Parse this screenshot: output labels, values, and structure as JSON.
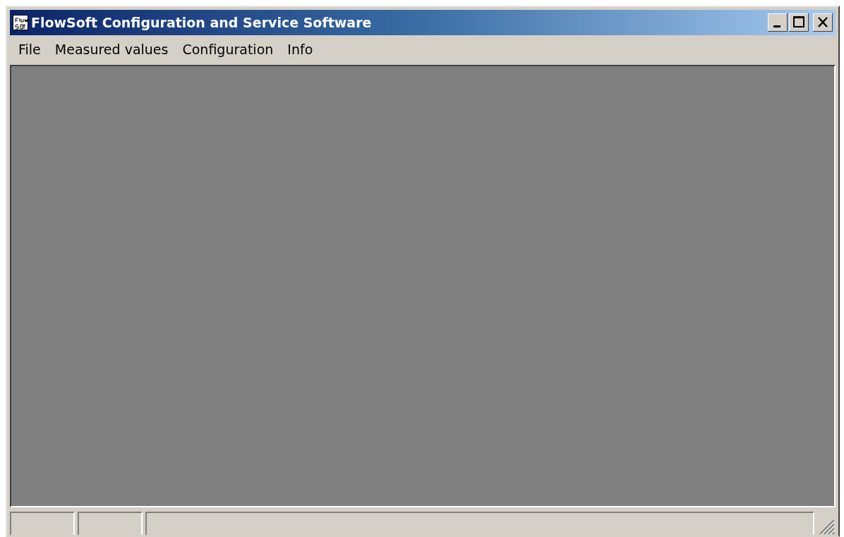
{
  "window": {
    "title": "FlowSoft Configuration and Service Software"
  },
  "menu": [
    {
      "label": "File"
    },
    {
      "label": "Measured values"
    },
    {
      "label": "Configuration"
    },
    {
      "label": "Info"
    }
  ]
}
